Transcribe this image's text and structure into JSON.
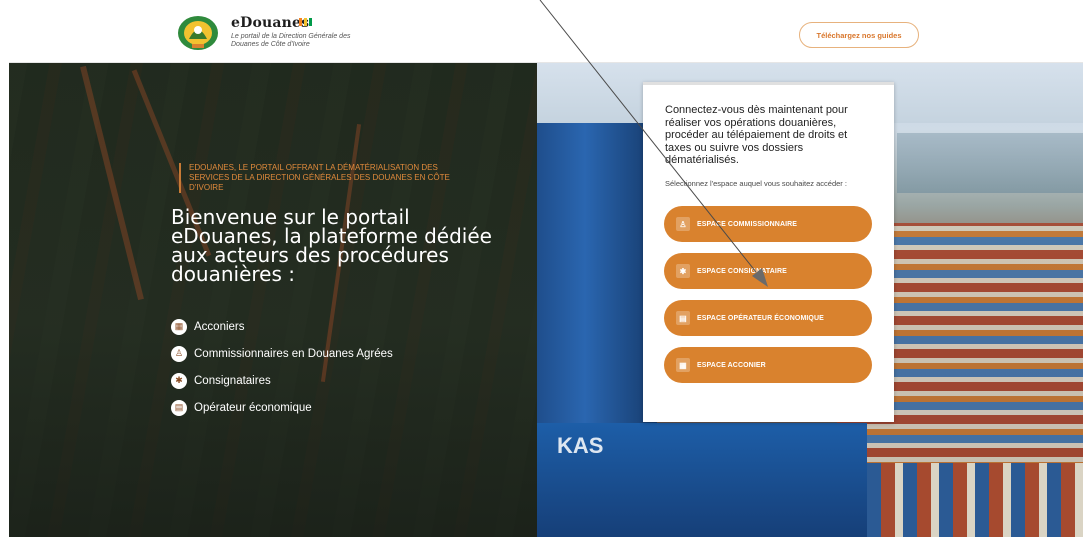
{
  "header": {
    "brand_name": "eDouanes",
    "tagline": "Le portail de la Direction Générale des Douanes de Côte d'Ivoire",
    "guide_button": "Téléchargez nos guides",
    "flag_colors": [
      "#f58220",
      "#ffffff",
      "#009a49"
    ]
  },
  "hero": {
    "eyebrow": "EDOUANES, LE PORTAIL OFFRANT LA DÉMATÉRIALISATION DES SERVICES DE LA DIRECTION GÉNÉRALES DES DOUANES EN CÔTE D'IVOIRE",
    "title": "Bienvenue sur le portail eDouanes, la plateforme dédiée aux acteurs des procédures douanières :",
    "features": [
      {
        "label": "Acconiers",
        "icon": "acconier-icon"
      },
      {
        "label": "Commissionnaires en Douanes Agrées",
        "icon": "commissionnaire-icon"
      },
      {
        "label": "Consignataires",
        "icon": "consignataire-icon"
      },
      {
        "label": "Opérateur économique",
        "icon": "operateur-icon"
      }
    ],
    "background_text": "KAS"
  },
  "card": {
    "intro": "Connectez-vous dès maintenant pour réaliser vos opérations douanières, procéder au télépaiement de droits et taxes ou suivre vos dossiers dématérialisés.",
    "prompt": "Sélectionnez l'espace auquel vous souhaitez accéder :",
    "buttons": [
      {
        "label": "ESPACE COMMISSIONNAIRE",
        "icon": "commissionnaire-icon"
      },
      {
        "label": "ESPACE CONSIGNATAIRE",
        "icon": "consignataire-icon"
      },
      {
        "label": "ESPACE OPÉRATEUR ÉCONOMIQUE",
        "icon": "operateur-icon"
      },
      {
        "label": "ESPACE ACCONIER",
        "icon": "acconier-icon"
      }
    ]
  },
  "colors": {
    "accent": "#d9822e",
    "accent_text": "#e08a3c",
    "guide_border": "#e7b27d"
  }
}
